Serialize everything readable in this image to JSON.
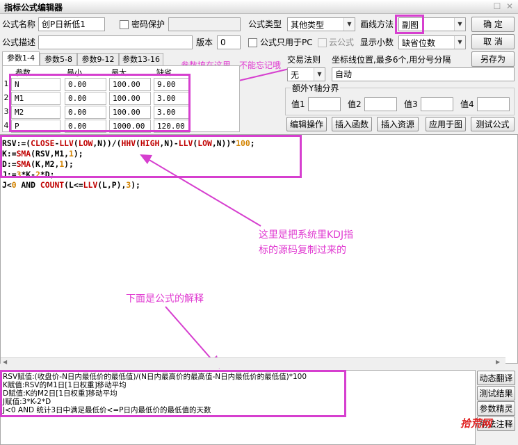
{
  "window": {
    "title": "指标公式编辑器"
  },
  "form": {
    "name_label": "公式名称",
    "name_value": "创P日新低1",
    "password_label": "密码保护",
    "type_label": "公式类型",
    "type_value": "其他类型",
    "draw_label": "画线方法",
    "draw_value": "副图",
    "desc_label": "公式描述",
    "version_label": "版本",
    "version_value": "0",
    "pc_only_label": "公式只用于PC",
    "cloud_label": "云公式",
    "decimal_label": "显示小数",
    "decimal_value": "缺省位数",
    "trade_rule_label": "交易法则",
    "trade_rule_value": "无",
    "coord_label": "坐标线位置,最多6个,用分号分隔",
    "coord_value": "自动",
    "extra_axis_label": "额外Y轴分界",
    "val1": "值1",
    "val2": "值2",
    "val3": "值3",
    "val4": "值4"
  },
  "buttons": {
    "ok": "确  定",
    "cancel": "取  消",
    "save_as": "另存为",
    "edit_op": "编辑操作",
    "insert_func": "插入函数",
    "insert_res": "插入资源",
    "apply_chart": "应用于图",
    "test": "测试公式"
  },
  "tabs": [
    "参数1-4",
    "参数5-8",
    "参数9-12",
    "参数13-16"
  ],
  "params": {
    "headers": [
      "参数",
      "最小",
      "最大",
      "缺省"
    ],
    "rows": [
      {
        "num": "1",
        "name": "N",
        "min": "0.00",
        "max": "100.00",
        "def": "9.00"
      },
      {
        "num": "2",
        "name": "M1",
        "min": "0.00",
        "max": "100.00",
        "def": "3.00"
      },
      {
        "num": "3",
        "name": "M2",
        "min": "0.00",
        "max": "100.00",
        "def": "3.00"
      },
      {
        "num": "4",
        "name": "P",
        "min": "0.00",
        "max": "1000.00",
        "def": "120.00"
      }
    ]
  },
  "annotations": {
    "params_note": "参数填在这里，不能忘记哦",
    "code_note_1": "这里是把系统里KDJ指",
    "code_note_2": "标的源码复制过来的",
    "explain_note": "下面是公式的解释"
  },
  "explain_lines": [
    "RSV赋值:(收盘价-N日内最低价的最低值)/(N日内最高价的最高值-N日内最低价的最低值)*100",
    "K赋值:RSV的M1日[1日权重]移动平均",
    "D赋值:K的M2日[1日权重]移动平均",
    "J赋值:3*K-2*D",
    "J<0 AND 统计3日中满足最低价<=P日内最低价的最低值的天数"
  ],
  "side_buttons": [
    "动态翻译",
    "测试结果",
    "参数精灵",
    "用法注释"
  ],
  "watermark": "拾荒网",
  "colors": {
    "annotation": "#d63fcf",
    "function": "#c00000",
    "number": "#d38300"
  }
}
